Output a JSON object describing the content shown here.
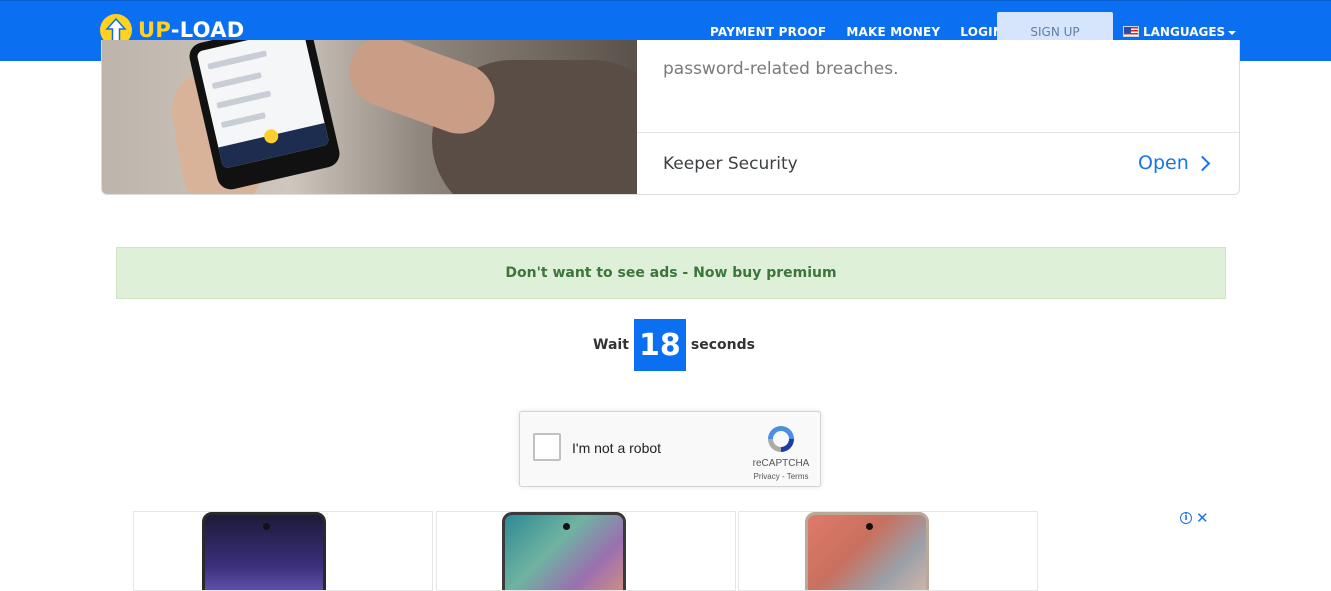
{
  "header": {
    "logo_up": "UP",
    "logo_rest": "-LOAD",
    "nav": [
      "PAYMENT PROOF",
      "MAKE MONEY",
      "LOGIN"
    ],
    "signup_label": "SIGN UP",
    "languages_label": "LANGUAGES"
  },
  "ad": {
    "text": "password-related breaches.",
    "brand": "Keeper Security",
    "cta": "Open"
  },
  "premium_text": "Don't want to see ads - Now buy premium",
  "countdown": {
    "prefix": "Wait",
    "value": "18",
    "suffix": "seconds"
  },
  "recaptcha": {
    "label": "I'm not a robot",
    "brand": "reCAPTCHA",
    "links": "Privacy - Terms"
  },
  "colors": {
    "brand_blue": "#0b6ff2",
    "logo_yellow": "#ffd21f",
    "premium_bg": "#dff0d8",
    "premium_text": "#3c763d"
  }
}
